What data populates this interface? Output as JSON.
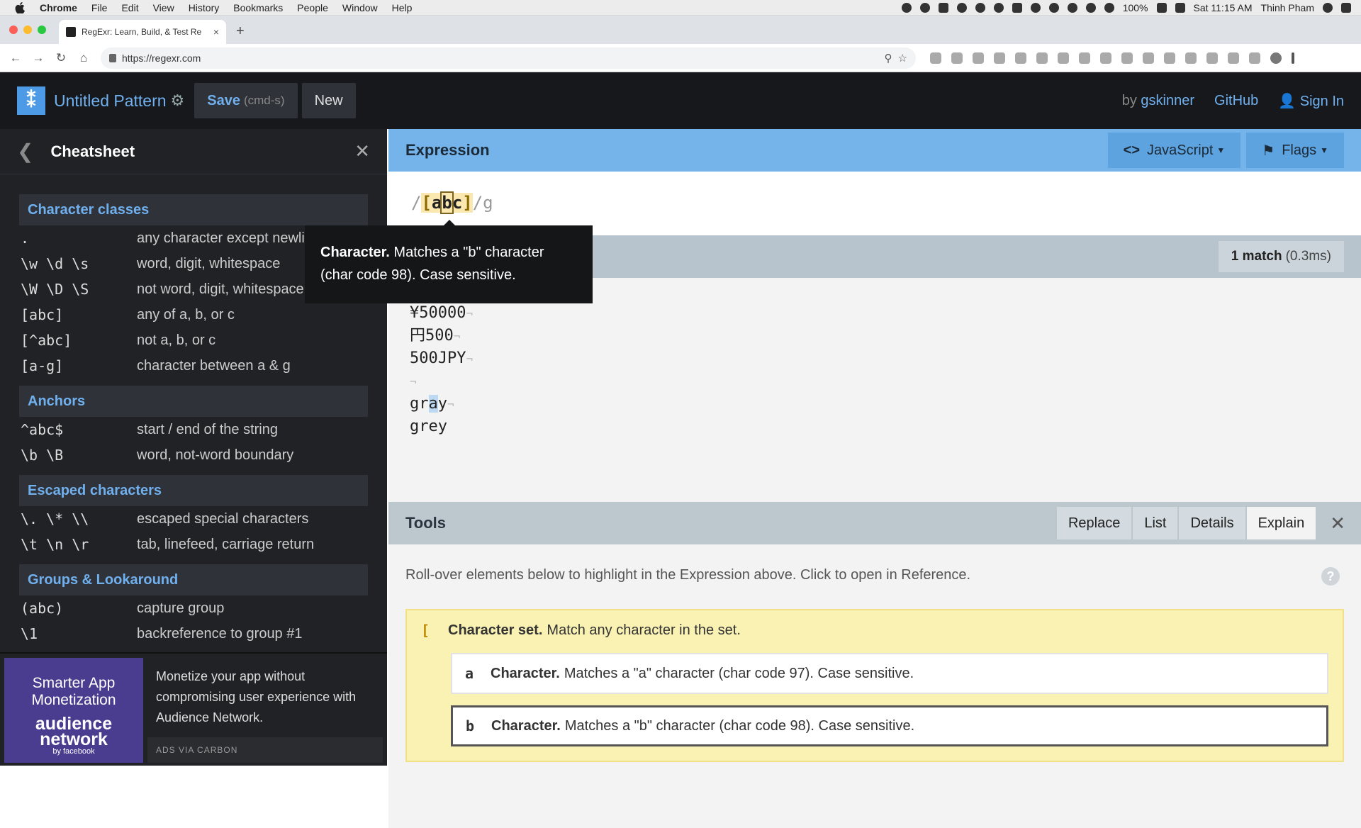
{
  "menubar": {
    "app_name": "Chrome",
    "items": [
      "File",
      "Edit",
      "View",
      "History",
      "Bookmarks",
      "People",
      "Window",
      "Help"
    ],
    "battery": "100%",
    "clock": "Sat 11:15 AM",
    "user": "Thinh Pham"
  },
  "browser": {
    "tab_title": "RegExr: Learn, Build, & Test Re",
    "tab_close": "×",
    "new_tab": "+",
    "url": "https://regexr.com"
  },
  "header": {
    "logo_glyph": "⁑",
    "pattern_title": "Untitled Pattern",
    "save_label": "Save",
    "save_hint": "(cmd-s)",
    "new_label": "New",
    "by_label": "by",
    "author": "gskinner",
    "github_label": "GitHub",
    "signin_label": "Sign In"
  },
  "cheatsheet": {
    "title": "Cheatsheet",
    "sections": [
      {
        "title": "Character classes",
        "rows": [
          {
            "k": ".",
            "v": "any character except newline"
          },
          {
            "k": "\\w \\d \\s",
            "v": "word, digit, whitespace"
          },
          {
            "k": "\\W \\D \\S",
            "v": "not word, digit, whitespace"
          },
          {
            "k": "[abc]",
            "v": "any of a, b, or c"
          },
          {
            "k": "[^abc]",
            "v": "not a, b, or c"
          },
          {
            "k": "[a-g]",
            "v": "character between a & g"
          }
        ]
      },
      {
        "title": "Anchors",
        "rows": [
          {
            "k": "^abc$",
            "v": "start / end of the string"
          },
          {
            "k": "\\b \\B",
            "v": "word, not-word boundary"
          }
        ]
      },
      {
        "title": "Escaped characters",
        "rows": [
          {
            "k": "\\. \\* \\\\",
            "v": "escaped special characters"
          },
          {
            "k": "\\t \\n \\r",
            "v": "tab, linefeed, carriage return"
          }
        ]
      },
      {
        "title": "Groups & Lookaround",
        "rows": [
          {
            "k": "(abc)",
            "v": "capture group"
          },
          {
            "k": "\\1",
            "v": "backreference to group #1"
          }
        ]
      }
    ]
  },
  "ad": {
    "image_line1": "Smarter App Monetization",
    "image_brand": "audience network",
    "image_by": "by facebook",
    "text": "Monetize your app without compromising user experience with Audience Network.",
    "via": "ADS VIA CARBON"
  },
  "expression": {
    "title": "Expression",
    "flavor_label": "JavaScript",
    "flags_label": "Flags",
    "open_slash": "/",
    "open_bracket": "[",
    "char_a": "a",
    "char_b": "b",
    "char_c": "c",
    "close_bracket": "]",
    "close_slash": "/",
    "flags": "g"
  },
  "tooltip": {
    "bold": "Character.",
    "text": "Matches a \"b\" character (char code 98). Case sensitive."
  },
  "text": {
    "match_count": "1 match",
    "match_time": "(0.3ms)",
    "lines": [
      "¥50000",
      "円500",
      "500JPY",
      "",
      "gray",
      "grey"
    ],
    "line_end_mark": "¬",
    "gray_pre": "gr",
    "gray_match": "a",
    "gray_post": "y"
  },
  "tools": {
    "title": "Tools",
    "tabs": [
      "Replace",
      "List",
      "Details",
      "Explain"
    ],
    "active_tab": "Explain",
    "hint": "Roll-over elements below to highlight in the Expression above. Click to open in Reference.",
    "help": "?",
    "set_token": "[",
    "set_title": "Character set.",
    "set_desc": "Match any character in the set.",
    "items": [
      {
        "token": "a",
        "title": "Character.",
        "desc": "Matches a \"a\" character (char code 97). Case sensitive."
      },
      {
        "token": "b",
        "title": "Character.",
        "desc": "Matches a \"b\" character (char code 98). Case sensitive."
      }
    ]
  }
}
